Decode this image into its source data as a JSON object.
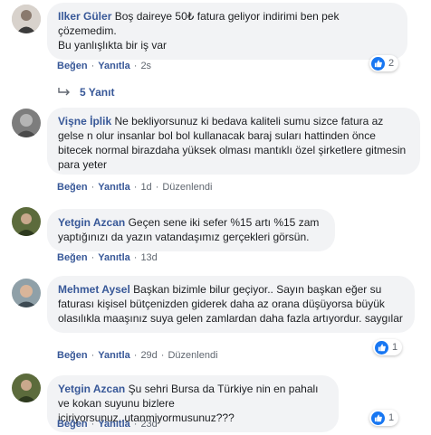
{
  "comments": [
    {
      "author": "Ilker Güler",
      "text": "Boş daireye 50₺ fatura geliyor indirimi ben pek çözemedim.",
      "text2": "Bu yanlışlıkta bir iş var",
      "like": "Beğen",
      "reply": "Yanıtla",
      "time": "2s",
      "reactions": "2",
      "replies_label": "5 Yanıt"
    },
    {
      "author": "Vişne İplik",
      "text": "Ne bekliyorsunuz ki bedava kaliteli sumu sizce fatura az gelse n olur insanlar bol bol kullanacak baraj suları hattinden önce bitecek normal birazdaha yüksek olması mantıklı özel şirketlere gitmesin para yeter",
      "like": "Beğen",
      "reply": "Yanıtla",
      "time": "1d",
      "edited": "Düzenlendi"
    },
    {
      "author": "Yetgin Azcan",
      "text": "Geçen sene iki sefer %15 artı %15 zam yaptığınızı da yazın vatandaşımız gerçekleri görsün.",
      "like": "Beğen",
      "reply": "Yanıtla",
      "time": "13d"
    },
    {
      "author": "Mehmet Aysel",
      "text": "Başkan bizimle bilur geçiyor.. Sayın başkan eğer su faturası kişisel bütçenizden giderek daha az orana düşüyorsa büyük olasılıkla maaşınız suya gelen zamlardan daha fazla artıyordur. saygılar",
      "like": "Beğen",
      "reply": "Yanıtla",
      "time": "29d",
      "edited": "Düzenlendi",
      "reactions": "1"
    },
    {
      "author": "Yetgin Azcan",
      "text": "Şu sehri Bursa da Türkiye nin en pahalı ve kokan suyunu bizlere iciriyorsunuz..utanmiyormusunuz???",
      "like": "Beğen",
      "reply": "Yanıtla",
      "time": "23d",
      "reactions": "1"
    }
  ]
}
